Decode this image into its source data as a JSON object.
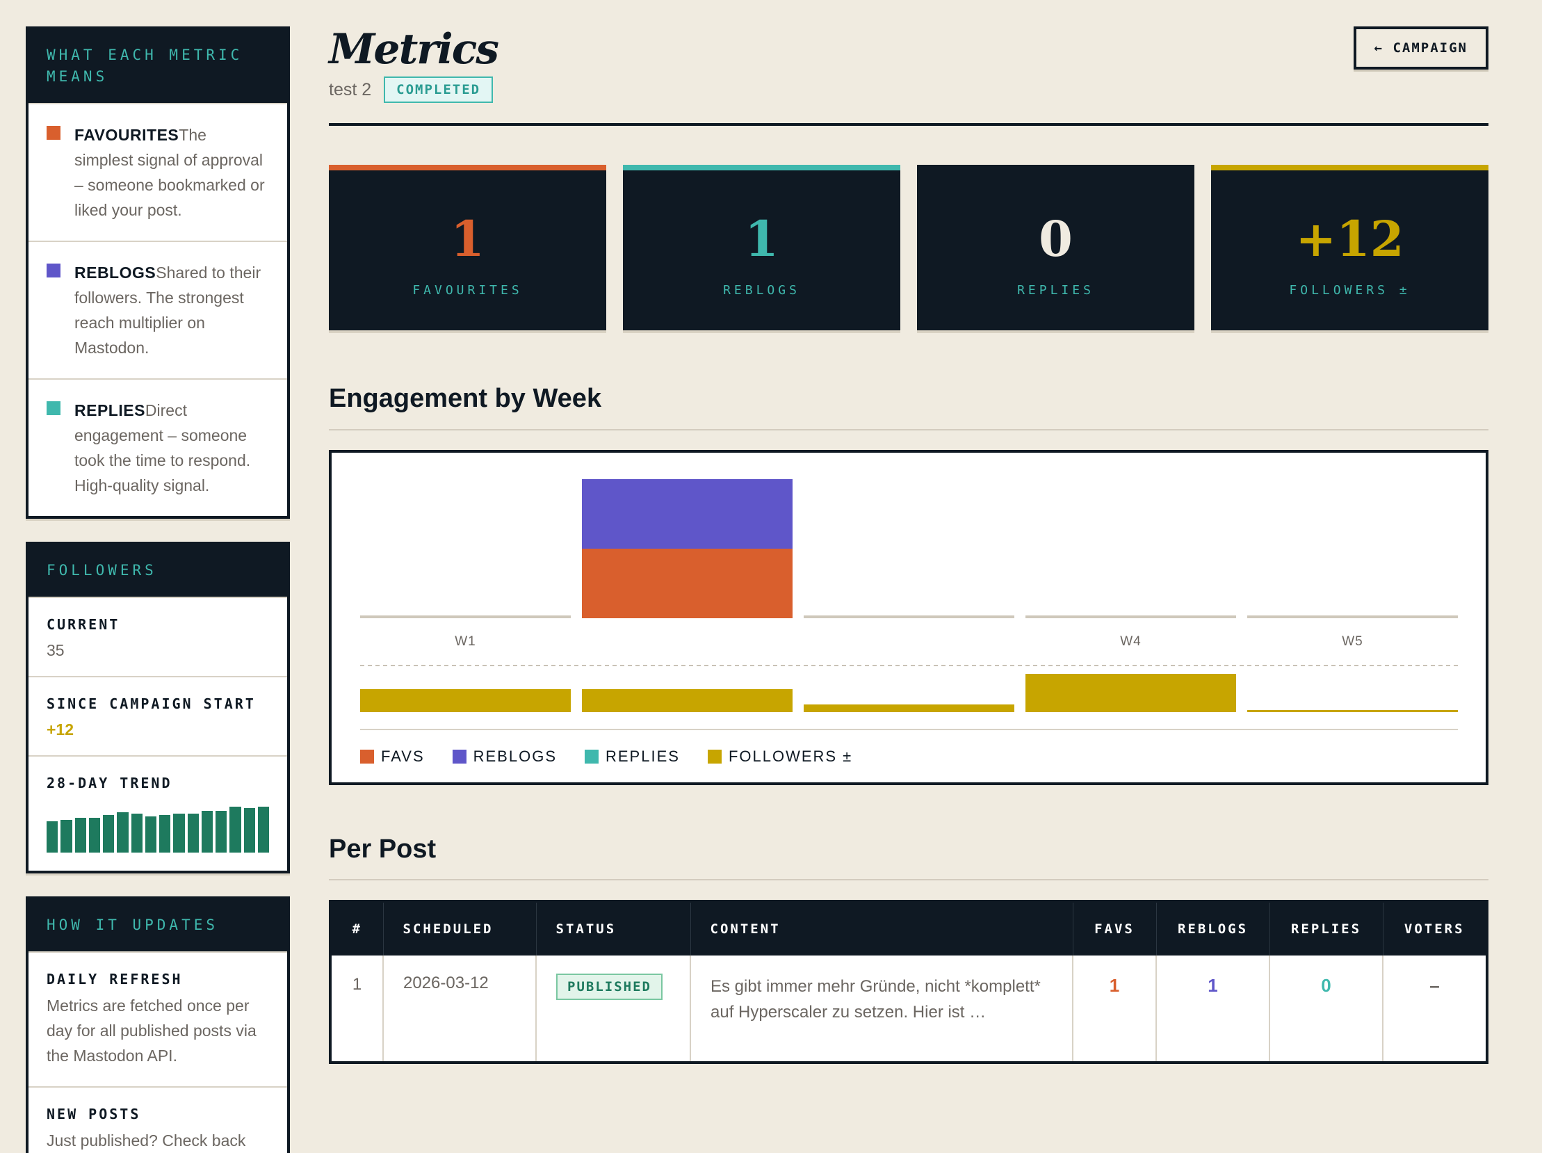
{
  "sidebar": {
    "metrics_panel": {
      "title": "WHAT EACH METRIC MEANS",
      "items": [
        {
          "name": "FAVOURITES",
          "desc": "The simplest signal of approval – someone bookmarked or liked your post.",
          "color": "#d95f2d"
        },
        {
          "name": "REBLOGS",
          "desc": "Shared to their followers. The strongest reach multiplier on Mastodon.",
          "color": "#5f56c9"
        },
        {
          "name": "REPLIES",
          "desc": "Direct engagement – someone took the time to respond. High-quality signal.",
          "color": "#3fb8ad"
        }
      ]
    },
    "followers_panel": {
      "title": "FOLLOWERS",
      "current_label": "CURRENT",
      "current_value": "35",
      "since_label": "SINCE CAMPAIGN START",
      "since_value": "+12",
      "trend_label": "28-DAY TREND",
      "trend_values": [
        23,
        24,
        26,
        26,
        28,
        30,
        29,
        27,
        28,
        29,
        29,
        31,
        31,
        34,
        33,
        34
      ]
    },
    "updates_panel": {
      "title": "HOW IT UPDATES",
      "daily_label": "DAILY REFRESH",
      "daily_desc": "Metrics are fetched once per day for all published posts via the Mastodon API.",
      "new_label": "NEW POSTS",
      "new_desc": "Just published? Check back"
    }
  },
  "header": {
    "title": "Metrics",
    "campaign": "test 2",
    "status": "COMPLETED",
    "back_button": "← CAMPAIGN"
  },
  "stats": [
    {
      "value": "1",
      "label": "FAVOURITES",
      "color": "#d95f2d"
    },
    {
      "value": "1",
      "label": "REBLOGS",
      "color": "#3fb8ad"
    },
    {
      "value": "0",
      "label": "REPLIES",
      "color": "#f0ebe0"
    },
    {
      "value": "+12",
      "label": "FOLLOWERS ±",
      "color": "#c7a500"
    }
  ],
  "engagement_section": {
    "title": "Engagement by Week"
  },
  "chart_data": {
    "type": "bar",
    "title": "Engagement by Week",
    "categories": [
      "W1",
      "",
      "",
      "W4",
      "W5"
    ],
    "series": [
      {
        "name": "FAVS",
        "values": [
          0,
          1,
          0,
          0,
          0
        ],
        "color": "#d95f2d"
      },
      {
        "name": "REBLOGS",
        "values": [
          0,
          1,
          0,
          0,
          0
        ],
        "color": "#5f56c9"
      },
      {
        "name": "REPLIES",
        "values": [
          0,
          0,
          0,
          0,
          0
        ],
        "color": "#3fb8ad"
      },
      {
        "name": "FOLLOWERS ±",
        "values": [
          3,
          3,
          1,
          5,
          0
        ],
        "color": "#c7a500"
      }
    ],
    "legend": [
      "FAVS",
      "REBLOGS",
      "REPLIES",
      "FOLLOWERS ±"
    ],
    "legend_position": "bottom-left",
    "grid": false
  },
  "per_post_section": {
    "title": "Per Post"
  },
  "table": {
    "headers": [
      "#",
      "SCHEDULED",
      "STATUS",
      "CONTENT",
      "FAVS",
      "REBLOGS",
      "REPLIES",
      "VOTERS"
    ],
    "rows": [
      {
        "index": "1",
        "scheduled": "2026-03-12",
        "status": "PUBLISHED",
        "content": "Es gibt immer mehr Gründe, nicht *komplett* auf Hyperscaler zu setzen. Hier ist …",
        "favs": "1",
        "reblogs": "1",
        "replies": "0",
        "voters": "–"
      }
    ]
  }
}
